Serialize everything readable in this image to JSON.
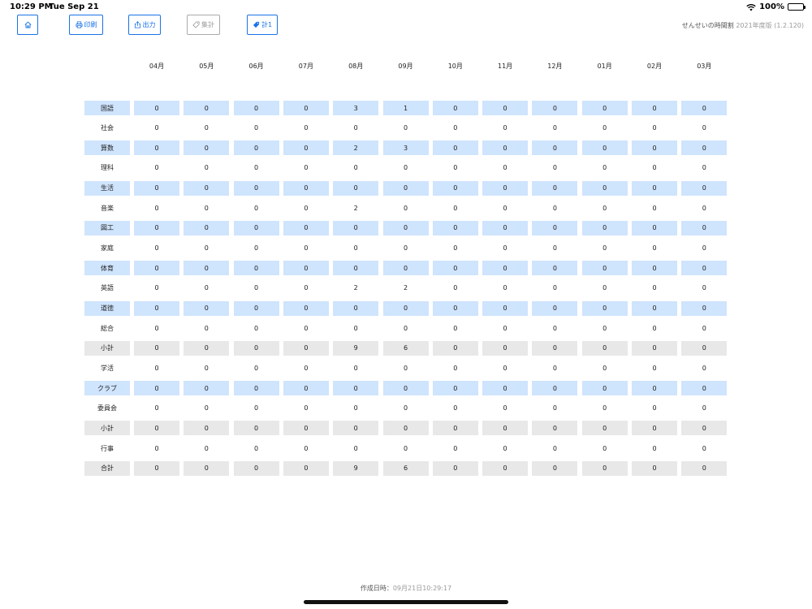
{
  "status_bar": {
    "time": "10:29 PM",
    "date": "Tue Sep 21",
    "battery": "100%"
  },
  "toolbar": {
    "print_label": "印刷",
    "export_label": "出力",
    "tally_label": "集計",
    "total_label": "計1"
  },
  "app": {
    "name": "せんせいの時間割",
    "edition": "2021年度版",
    "version": "(1.2.120)"
  },
  "months": [
    "04月",
    "05月",
    "06月",
    "07月",
    "08月",
    "09月",
    "10月",
    "11月",
    "12月",
    "01月",
    "02月",
    "03月"
  ],
  "rows": [
    {
      "label": "国語",
      "style": "blue",
      "values": [
        "0",
        "0",
        "0",
        "0",
        "3",
        "1",
        "0",
        "0",
        "0",
        "0",
        "0",
        "0"
      ]
    },
    {
      "label": "社会",
      "style": "plain",
      "values": [
        "0",
        "0",
        "0",
        "0",
        "0",
        "0",
        "0",
        "0",
        "0",
        "0",
        "0",
        "0"
      ]
    },
    {
      "label": "算数",
      "style": "blue",
      "values": [
        "0",
        "0",
        "0",
        "0",
        "2",
        "3",
        "0",
        "0",
        "0",
        "0",
        "0",
        "0"
      ]
    },
    {
      "label": "理科",
      "style": "plain",
      "values": [
        "0",
        "0",
        "0",
        "0",
        "0",
        "0",
        "0",
        "0",
        "0",
        "0",
        "0",
        "0"
      ]
    },
    {
      "label": "生活",
      "style": "blue",
      "values": [
        "0",
        "0",
        "0",
        "0",
        "0",
        "0",
        "0",
        "0",
        "0",
        "0",
        "0",
        "0"
      ]
    },
    {
      "label": "音楽",
      "style": "plain",
      "values": [
        "0",
        "0",
        "0",
        "0",
        "2",
        "0",
        "0",
        "0",
        "0",
        "0",
        "0",
        "0"
      ]
    },
    {
      "label": "図工",
      "style": "blue",
      "values": [
        "0",
        "0",
        "0",
        "0",
        "0",
        "0",
        "0",
        "0",
        "0",
        "0",
        "0",
        "0"
      ]
    },
    {
      "label": "家庭",
      "style": "plain",
      "values": [
        "0",
        "0",
        "0",
        "0",
        "0",
        "0",
        "0",
        "0",
        "0",
        "0",
        "0",
        "0"
      ]
    },
    {
      "label": "体育",
      "style": "blue",
      "values": [
        "0",
        "0",
        "0",
        "0",
        "0",
        "0",
        "0",
        "0",
        "0",
        "0",
        "0",
        "0"
      ]
    },
    {
      "label": "英語",
      "style": "plain",
      "values": [
        "0",
        "0",
        "0",
        "0",
        "2",
        "2",
        "0",
        "0",
        "0",
        "0",
        "0",
        "0"
      ]
    },
    {
      "label": "道徳",
      "style": "blue",
      "values": [
        "0",
        "0",
        "0",
        "0",
        "0",
        "0",
        "0",
        "0",
        "0",
        "0",
        "0",
        "0"
      ]
    },
    {
      "label": "総合",
      "style": "plain",
      "values": [
        "0",
        "0",
        "0",
        "0",
        "0",
        "0",
        "0",
        "0",
        "0",
        "0",
        "0",
        "0"
      ]
    },
    {
      "label": "小計",
      "style": "gray",
      "values": [
        "0",
        "0",
        "0",
        "0",
        "9",
        "6",
        "0",
        "0",
        "0",
        "0",
        "0",
        "0"
      ]
    },
    {
      "label": "学活",
      "style": "plain",
      "values": [
        "0",
        "0",
        "0",
        "0",
        "0",
        "0",
        "0",
        "0",
        "0",
        "0",
        "0",
        "0"
      ]
    },
    {
      "label": "クラブ",
      "style": "blue",
      "values": [
        "0",
        "0",
        "0",
        "0",
        "0",
        "0",
        "0",
        "0",
        "0",
        "0",
        "0",
        "0"
      ]
    },
    {
      "label": "委員会",
      "style": "plain",
      "values": [
        "0",
        "0",
        "0",
        "0",
        "0",
        "0",
        "0",
        "0",
        "0",
        "0",
        "0",
        "0"
      ]
    },
    {
      "label": "小計",
      "style": "gray",
      "values": [
        "0",
        "0",
        "0",
        "0",
        "0",
        "0",
        "0",
        "0",
        "0",
        "0",
        "0",
        "0"
      ]
    },
    {
      "label": "行事",
      "style": "plain",
      "values": [
        "0",
        "0",
        "0",
        "0",
        "0",
        "0",
        "0",
        "0",
        "0",
        "0",
        "0",
        "0"
      ]
    },
    {
      "label": "合計",
      "style": "gray",
      "values": [
        "0",
        "0",
        "0",
        "0",
        "9",
        "6",
        "0",
        "0",
        "0",
        "0",
        "0",
        "0"
      ]
    }
  ],
  "footer": {
    "label": "作成日時：",
    "date": "09月21日",
    "time": "10:29:17"
  },
  "colors": {
    "accent": "#1a73e8",
    "row_blue": "#cfe4fd",
    "row_gray": "#e8e8e8"
  },
  "icons": {
    "home": "home-icon",
    "print": "printer-icon",
    "export": "share-icon",
    "tally": "tag-outline-icon",
    "total": "tag-filled-icon"
  }
}
